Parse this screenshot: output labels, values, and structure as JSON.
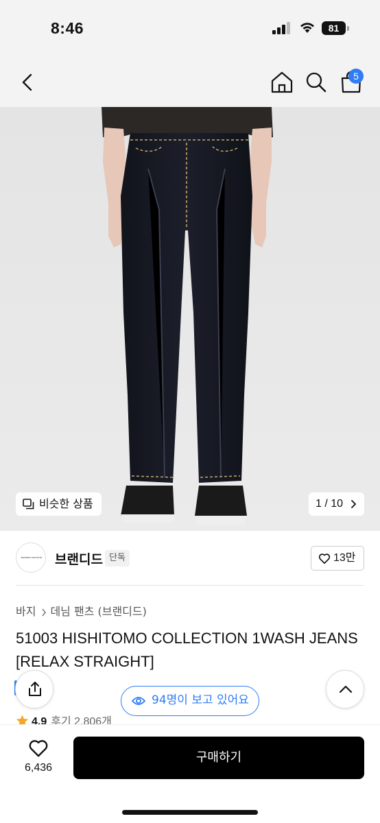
{
  "status_bar": {
    "time": "8:46",
    "battery": "81"
  },
  "nav": {
    "cart_count": "5",
    "icons": [
      "back-chevron-icon",
      "home-icon",
      "search-icon",
      "shopping-bag-icon"
    ]
  },
  "hero": {
    "similar_label": "비슷한 상품",
    "page_indicator": "1 / 10",
    "image": "model wearing dark raw denim straight jeans with black canvas sneakers"
  },
  "brand": {
    "logo_text": "BRANDED INDUSTRY",
    "name": "브랜디드",
    "tag": "단독",
    "likes": "13만"
  },
  "breadcrumb": [
    "바지",
    "데님 팬츠 (브랜디드)"
  ],
  "product": {
    "title": "51003 HISHITOMO COLLECTION 1WASH JEANS [RELAX STRAIGHT]",
    "rating": "4.9",
    "reviews": "후기 2,806개"
  },
  "floating": {
    "viewers": "94명이 보고 있어요"
  },
  "bottom_bar": {
    "wish_count": "6,436",
    "buy_label": "구매하기"
  },
  "colors": {
    "accent": "#2f7cf6",
    "buy_button": "#000000",
    "star": "#f5a623"
  }
}
